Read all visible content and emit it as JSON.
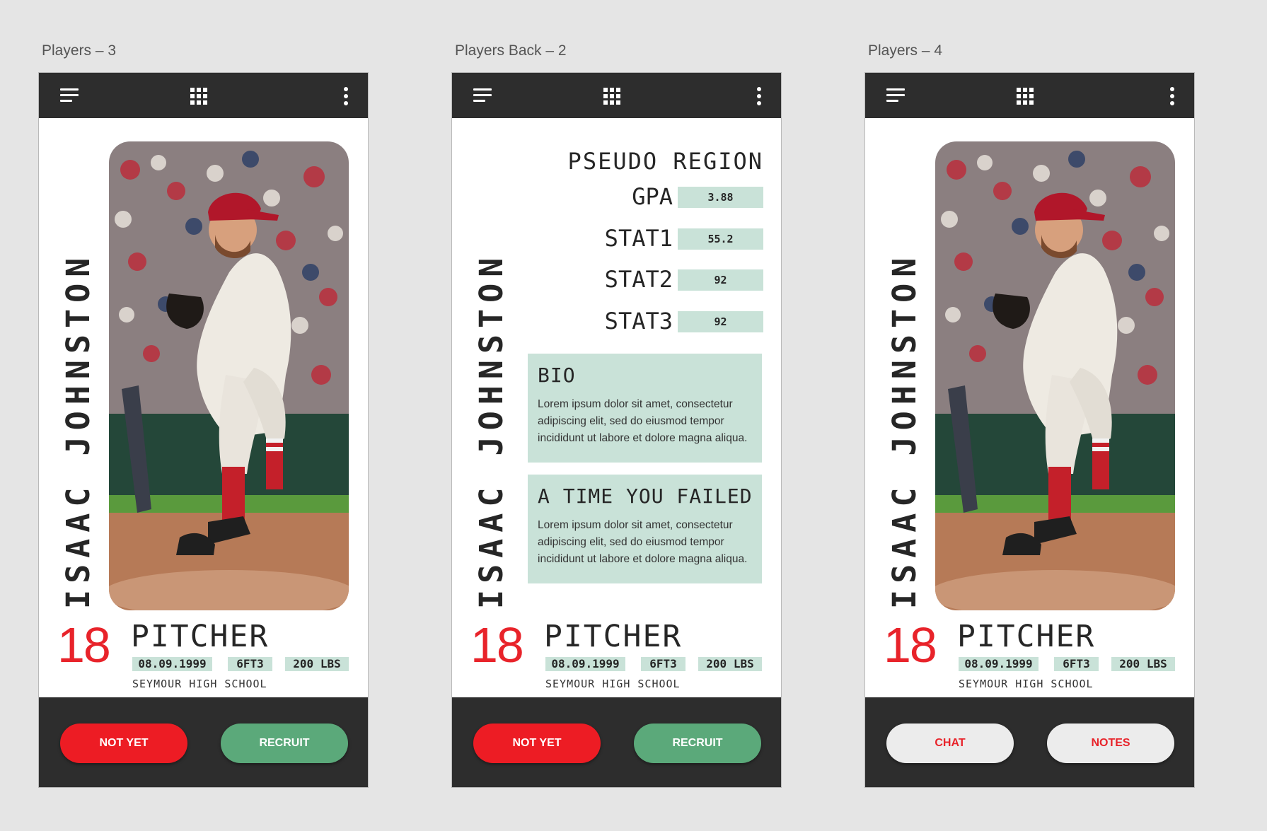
{
  "frames": [
    {
      "title": "Players – 3",
      "variant": "front",
      "name": "ISAAC JOHNSTON",
      "number": "18",
      "position": "PITCHER",
      "dob": "08.09.1999",
      "height": "6FT3",
      "weight": "200 LBS",
      "school": "SEYMOUR HIGH SCHOOL",
      "buttons": [
        {
          "label": "NOT YET",
          "style": "red"
        },
        {
          "label": "RECRUIT",
          "style": "green"
        }
      ]
    },
    {
      "title": "Players Back – 2",
      "variant": "back",
      "name": "ISAAC JOHNSTON",
      "number": "18",
      "position": "PITCHER",
      "dob": "08.09.1999",
      "height": "6FT3",
      "weight": "200 LBS",
      "school": "SEYMOUR HIGH SCHOOL",
      "region": "PSEUDO REGION",
      "stats": [
        {
          "label": "GPA",
          "value": "3.88"
        },
        {
          "label": "STAT1",
          "value": "55.2"
        },
        {
          "label": "STAT2",
          "value": "92"
        },
        {
          "label": "STAT3",
          "value": "92"
        }
      ],
      "bio": {
        "title": "BIO",
        "text": "Lorem ipsum dolor sit amet, consectetur adipiscing elit, sed do eiusmod tempor incididunt ut labore et dolore magna aliqua."
      },
      "failure": {
        "title": "A TIME YOU FAILED",
        "text": "Lorem ipsum dolor sit amet, consectetur adipiscing elit, sed do eiusmod tempor incididunt ut labore et dolore magna aliqua."
      },
      "buttons": [
        {
          "label": "NOT YET",
          "style": "red"
        },
        {
          "label": "RECRUIT",
          "style": "green"
        }
      ]
    },
    {
      "title": "Players – 4",
      "variant": "front",
      "name": "ISAAC JOHNSTON",
      "number": "18",
      "position": "PITCHER",
      "dob": "08.09.1999",
      "height": "6FT3",
      "weight": "200 LBS",
      "school": "SEYMOUR HIGH SCHOOL",
      "buttons": [
        {
          "label": "CHAT",
          "style": "light"
        },
        {
          "label": "NOTES",
          "style": "light"
        }
      ]
    }
  ],
  "icons": {
    "menu": "menu-lines-icon",
    "apps": "apps-grid-icon",
    "more": "more-vertical-icon"
  },
  "colors": {
    "background": "#e5e5e5",
    "bar": "#2d2d2d",
    "accent_red": "#ed1c24",
    "accent_green": "#5ba97a",
    "chip": "#c9e2d8",
    "button_light": "#ececec"
  }
}
